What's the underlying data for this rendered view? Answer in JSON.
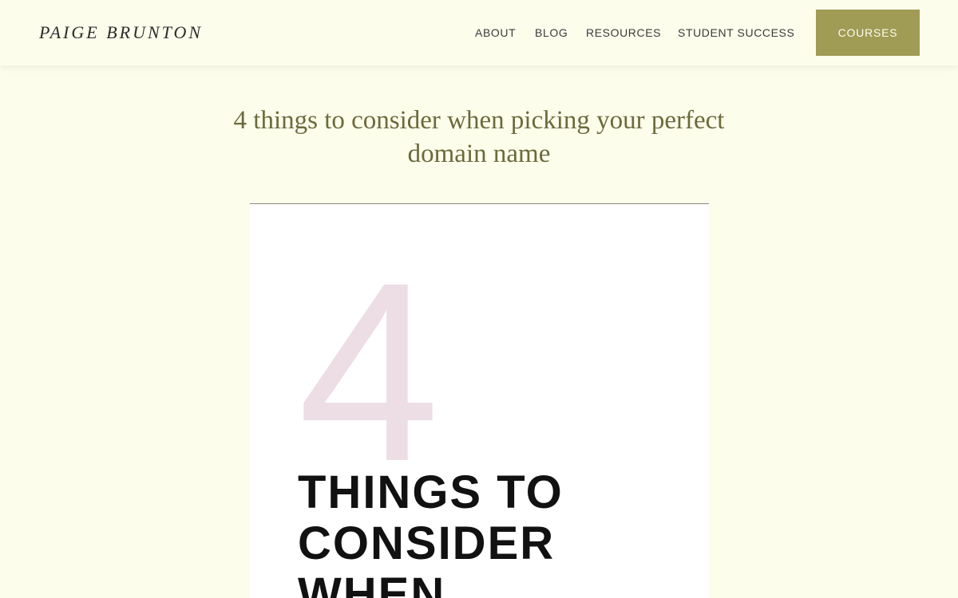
{
  "header": {
    "logo": "PAIGE BRUNTON",
    "nav": [
      {
        "label": "ABOUT"
      },
      {
        "label": "BLOG"
      },
      {
        "label": "RESOURCES"
      },
      {
        "label": "STUDENT SUCCESS"
      }
    ],
    "cta_label": "COURSES"
  },
  "post": {
    "title": "4 things to consider when picking your perfect domain name"
  },
  "feature_image": {
    "number": "4",
    "heading_lines": [
      "THINGS TO",
      "CONSIDER",
      "WHEN"
    ]
  },
  "colors": {
    "background": "#fdfdec",
    "accent": "#a09b55",
    "title": "#6b6a3c",
    "number": "#eddde5"
  }
}
